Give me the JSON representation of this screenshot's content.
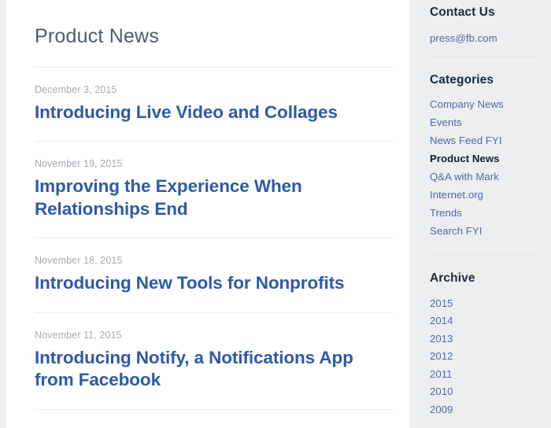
{
  "main": {
    "page_title": "Product News",
    "articles": [
      {
        "date": "December 3, 2015",
        "title": "Introducing Live Video and Collages"
      },
      {
        "date": "November 19, 2015",
        "title": "Improving the Experience When Relationships End"
      },
      {
        "date": "November 18, 2015",
        "title": "Introducing New Tools for Nonprofits"
      },
      {
        "date": "November 11, 2015",
        "title": "Introducing Notify, a Notifications App from Facebook"
      }
    ]
  },
  "sidebar": {
    "contact": {
      "heading": "Contact Us",
      "email": "press@fb.com"
    },
    "categories": {
      "heading": "Categories",
      "items": [
        {
          "label": "Company News",
          "active": false
        },
        {
          "label": "Events",
          "active": false
        },
        {
          "label": "News Feed FYI",
          "active": false
        },
        {
          "label": "Product News",
          "active": true
        },
        {
          "label": "Q&A with Mark",
          "active": false
        },
        {
          "label": "Internet.org",
          "active": false
        },
        {
          "label": "Trends",
          "active": false
        },
        {
          "label": "Search FYI",
          "active": false
        }
      ]
    },
    "archive": {
      "heading": "Archive",
      "years": [
        "2015",
        "2014",
        "2013",
        "2012",
        "2011",
        "2010",
        "2009"
      ]
    }
  },
  "colors": {
    "page_background": "#eceef0",
    "content_background": "#ffffff",
    "headline_blue": "#2d5aa6",
    "sidebar_link_blue": "#4e6aa8",
    "active_item": "#141e2e",
    "date_gray": "#a6abb2",
    "title_slate": "#4d5a6e",
    "rule_gray": "#ececec"
  }
}
